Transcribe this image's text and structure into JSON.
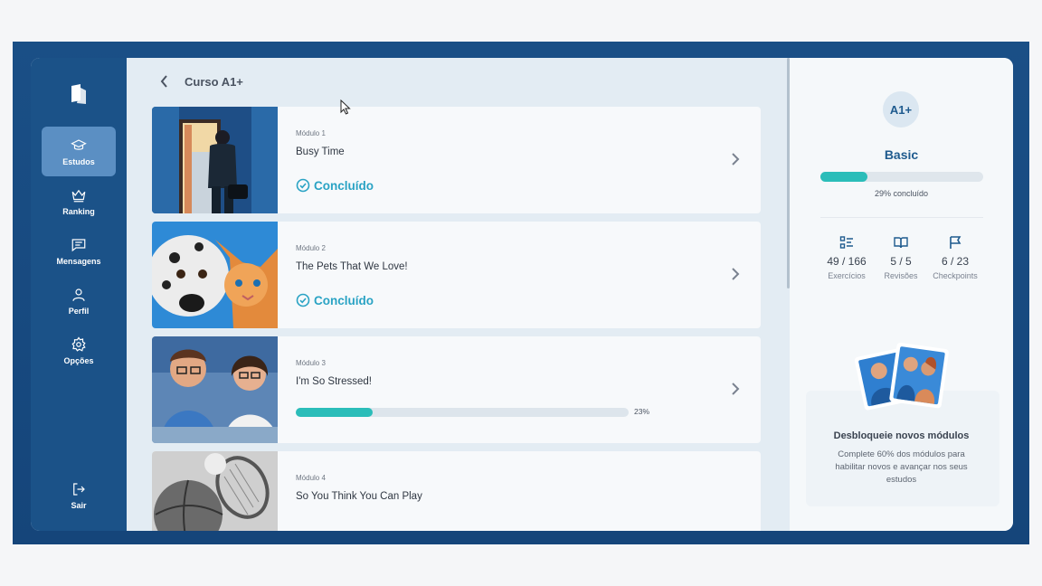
{
  "header": {
    "back_icon": "chevron-left-icon",
    "title": "Curso A1+"
  },
  "sidebar": {
    "items": [
      {
        "label": "Estudos",
        "icon": "graduation-cap-icon",
        "active": true
      },
      {
        "label": "Ranking",
        "icon": "crown-icon"
      },
      {
        "label": "Mensagens",
        "icon": "message-icon"
      },
      {
        "label": "Perfil",
        "icon": "user-icon"
      },
      {
        "label": "Opções",
        "icon": "gear-icon"
      },
      {
        "label": "Sair",
        "icon": "logout-icon"
      }
    ]
  },
  "modules": [
    {
      "label": "Módulo 1",
      "title": "Busy Time",
      "status": "Concluído"
    },
    {
      "label": "Módulo 2",
      "title": "The Pets That We Love!",
      "status": "Concluído"
    },
    {
      "label": "Módulo 3",
      "title": "I'm So Stressed!",
      "progress": 0.23,
      "progress_text": "23%"
    },
    {
      "label": "Módulo 4",
      "title": "So You Think You Can Play"
    }
  ],
  "level": {
    "badge": "A1+",
    "name": "Basic",
    "progress": 0.29,
    "progress_text": "29% concluído"
  },
  "stats": [
    {
      "value": "49 / 166",
      "label": "Exercícios",
      "icon": "exercise-list-icon"
    },
    {
      "value": "5 / 5",
      "label": "Revisões",
      "icon": "book-open-icon"
    },
    {
      "value": "6 / 23",
      "label": "Checkpoints",
      "icon": "flag-icon"
    }
  ],
  "promo": {
    "title": "Desbloqueie novos módulos",
    "text": "Complete 60% dos módulos para habilitar novos e avançar nos seus estudos"
  },
  "colors": {
    "accent": "#2bbdb9",
    "brand": "#1b5288",
    "status": "#2aa3c4"
  }
}
